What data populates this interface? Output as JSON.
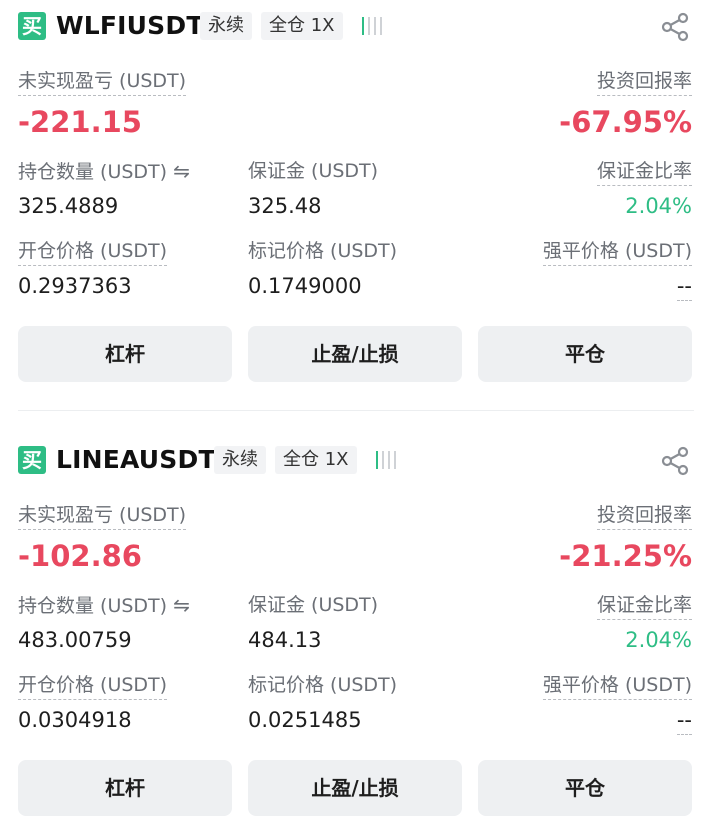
{
  "positions": [
    {
      "side": "买",
      "symbol": "WLFIUSDT",
      "contract_type": "永续",
      "margin_mode": "全仓 1X",
      "risk_bars_lit": 1,
      "risk_bars_total": 4,
      "unrealized_pnl_label": "未实现盈亏 (USDT)",
      "unrealized_pnl": "-221.15",
      "roe_label": "投资回报率",
      "roe": "-67.95%",
      "size_label": "持仓数量 (USDT)",
      "size": "325.4889",
      "margin_label": "保证金 (USDT)",
      "margin": "325.48",
      "margin_ratio_label": "保证金比率",
      "margin_ratio": "2.04%",
      "entry_price_label": "开仓价格 (USDT)",
      "entry_price": "0.2937363",
      "mark_price_label": "标记价格 (USDT)",
      "mark_price": "0.1749000",
      "liq_price_label": "强平价格 (USDT)",
      "liq_price": "--",
      "btn_leverage": "杠杆",
      "btn_tpsl": "止盈/止损",
      "btn_close": "平仓"
    },
    {
      "side": "买",
      "symbol": "LINEAUSDT",
      "contract_type": "永续",
      "margin_mode": "全仓 1X",
      "risk_bars_lit": 1,
      "risk_bars_total": 4,
      "unrealized_pnl_label": "未实现盈亏 (USDT)",
      "unrealized_pnl": "-102.86",
      "roe_label": "投资回报率",
      "roe": "-21.25%",
      "size_label": "持仓数量 (USDT)",
      "size": "483.00759",
      "margin_label": "保证金 (USDT)",
      "margin": "484.13",
      "margin_ratio_label": "保证金比率",
      "margin_ratio": "2.04%",
      "entry_price_label": "开仓价格 (USDT)",
      "entry_price": "0.0304918",
      "mark_price_label": "标记价格 (USDT)",
      "mark_price": "0.0251485",
      "liq_price_label": "强平价格 (USDT)",
      "liq_price": "--",
      "btn_leverage": "杠杆",
      "btn_tpsl": "止盈/止损",
      "btn_close": "平仓"
    }
  ],
  "icons": {
    "swap": "swap-arrows-icon",
    "share": "share-icon"
  },
  "colors": {
    "buy_green": "#2ebd85",
    "loss_red": "#e8485f"
  }
}
